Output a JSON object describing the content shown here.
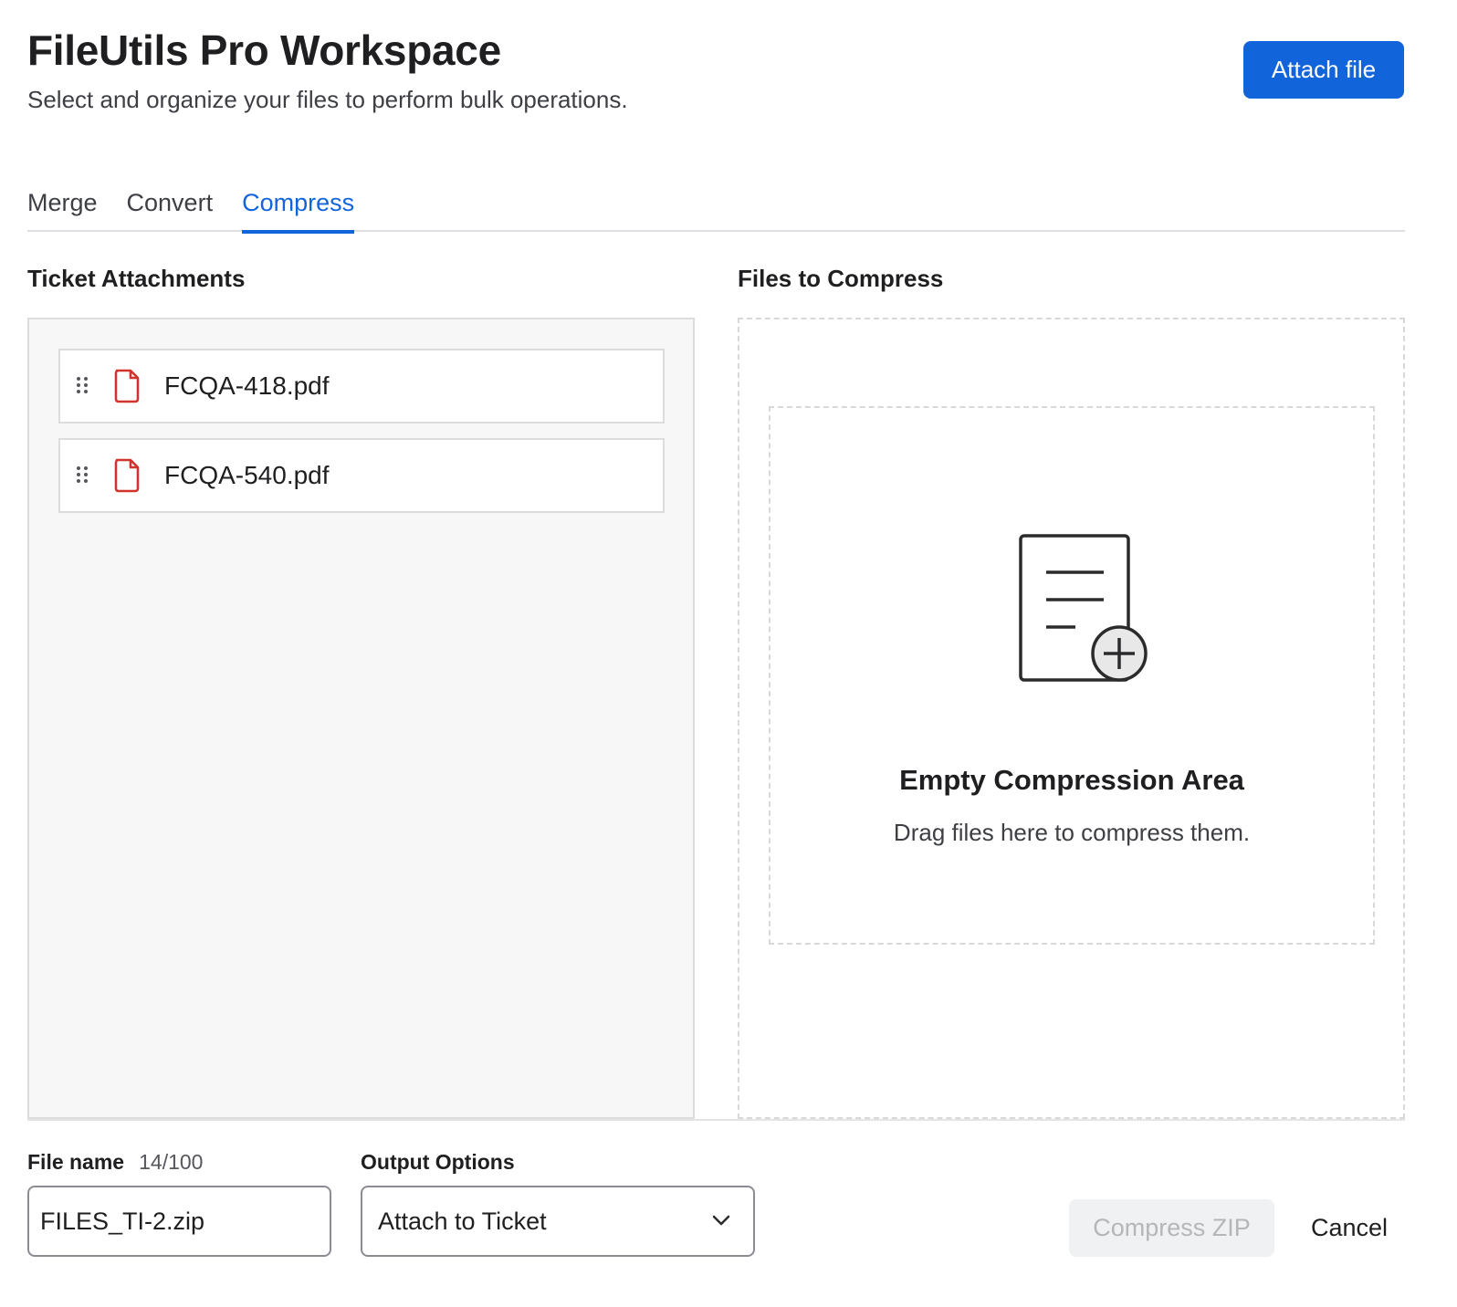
{
  "header": {
    "title": "FileUtils Pro Workspace",
    "subtitle": "Select and organize your files to perform bulk operations.",
    "attach_label": "Attach file"
  },
  "tabs": [
    {
      "label": "Merge",
      "active": false
    },
    {
      "label": "Convert",
      "active": false
    },
    {
      "label": "Compress",
      "active": true
    }
  ],
  "attachments": {
    "title": "Ticket Attachments",
    "items": [
      {
        "name": "FCQA-418.pdf",
        "icon": "pdf-file-icon"
      },
      {
        "name": "FCQA-540.pdf",
        "icon": "pdf-file-icon"
      }
    ]
  },
  "compress_zone": {
    "title": "Files to Compress",
    "empty_title": "Empty Compression Area",
    "empty_desc": "Drag files here to compress them.",
    "icon": "document-add-icon"
  },
  "form": {
    "file_name_label": "File name",
    "file_name_count": "14/100",
    "file_name_value": "FILES_TI-2.zip",
    "output_label": "Output Options",
    "output_value": "Attach to Ticket"
  },
  "actions": {
    "compress_label": "Compress ZIP",
    "cancel_label": "Cancel"
  },
  "colors": {
    "accent": "#1264db",
    "pdf_red": "#d0342c",
    "disabled_bg": "#f0f1f2",
    "disabled_text": "#b4b6ba"
  }
}
